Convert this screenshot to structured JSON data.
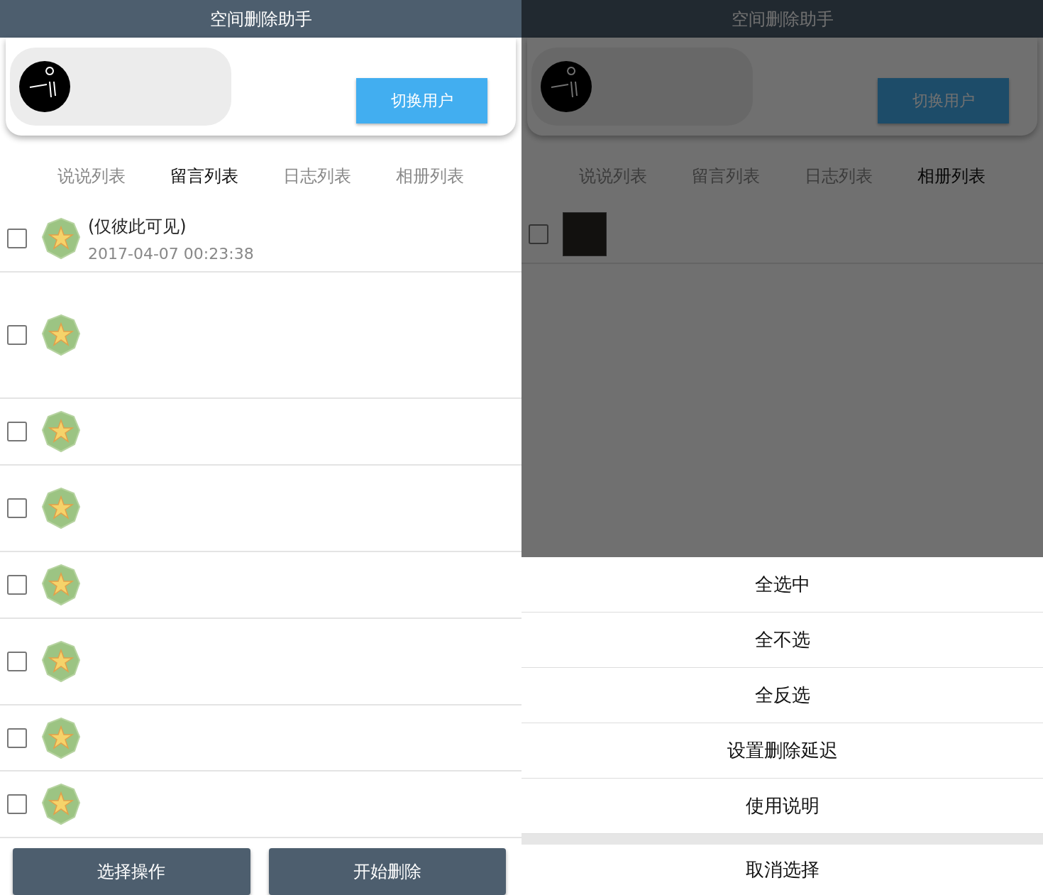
{
  "screens": [
    {
      "title": "空间删除助手",
      "switch_user": "切换用户",
      "tabs": [
        {
          "label": "说说列表",
          "selected": false
        },
        {
          "label": "留言列表",
          "selected": true
        },
        {
          "label": "日志列表",
          "selected": false
        },
        {
          "label": "相册列表",
          "selected": false
        }
      ],
      "rows": [
        {
          "kind": "message",
          "checked": false,
          "text": "(仅彼此可见)",
          "time": "2017-04-07 00:23:38"
        },
        {
          "kind": "message",
          "checked": false
        },
        {
          "kind": "message",
          "checked": false
        },
        {
          "kind": "message",
          "checked": false
        },
        {
          "kind": "message",
          "checked": false
        },
        {
          "kind": "message",
          "checked": false
        },
        {
          "kind": "message",
          "checked": false
        },
        {
          "kind": "message",
          "checked": false
        }
      ],
      "buttons": [
        "选择操作",
        "开始删除"
      ]
    },
    {
      "title": "空间删除助手",
      "switch_user": "切换用户",
      "tabs": [
        {
          "label": "说说列表",
          "selected": false
        },
        {
          "label": "留言列表",
          "selected": false
        },
        {
          "label": "日志列表",
          "selected": false
        },
        {
          "label": "相册列表",
          "selected": true
        }
      ],
      "rows": [
        {
          "kind": "photo",
          "checked": false
        }
      ],
      "menu": {
        "items": [
          "全选中",
          "全不选",
          "全反选",
          "设置删除延迟",
          "使用说明"
        ],
        "cancel": "取消选择"
      }
    }
  ]
}
